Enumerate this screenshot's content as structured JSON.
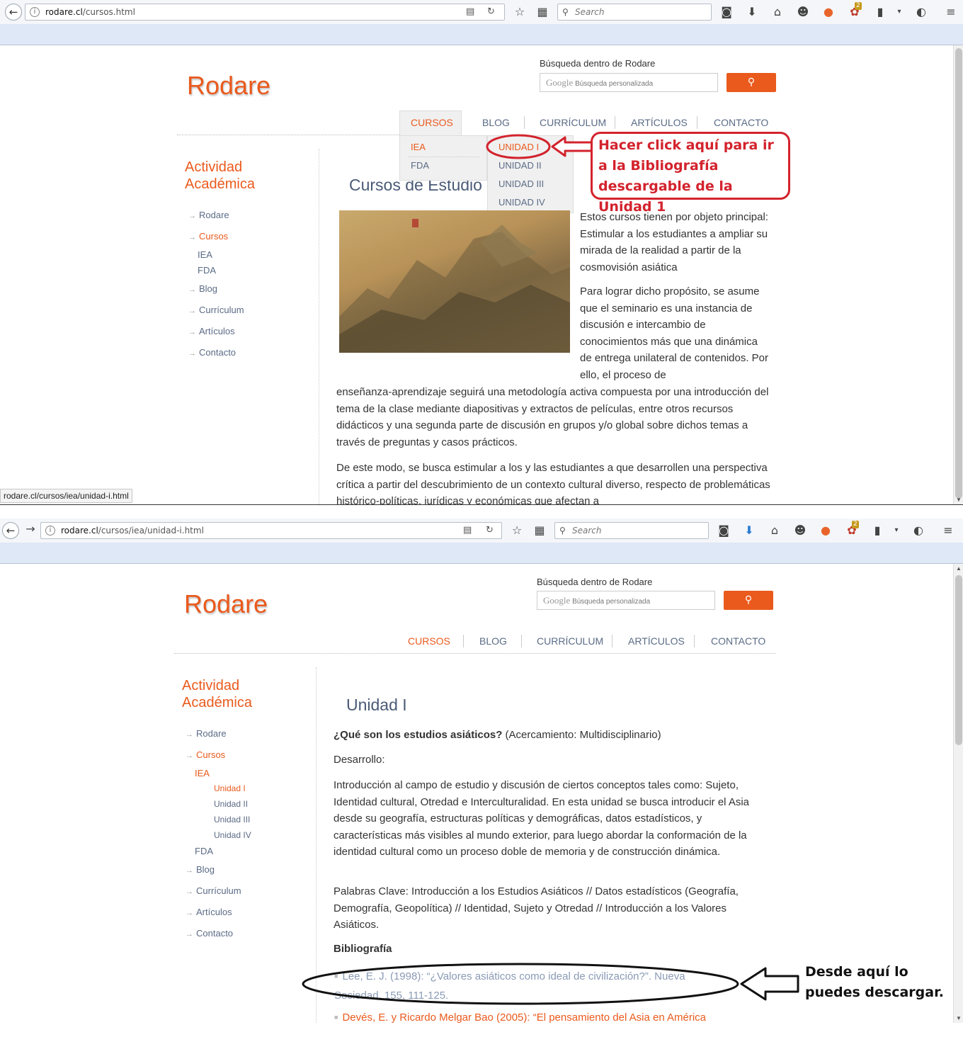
{
  "browser": {
    "search_placeholder": "Search",
    "badge_count": "2"
  },
  "window1": {
    "url_host": "rodare.cl",
    "url_path": "/cursos.html",
    "status_text": "rodare.cl/cursos/iea/unidad-i.html"
  },
  "window2": {
    "url_host": "rodare.cl",
    "url_path": "/cursos/iea/unidad-i.html"
  },
  "site": {
    "logo": "Rodare",
    "search_label": "Búsqueda dentro de Rodare",
    "search_placeholder": "Búsqueda personalizada",
    "google": "Google",
    "nav": [
      "CURSOS",
      "BLOG",
      "CURRÍCULUM",
      "ARTÍCULOS",
      "CONTACTO"
    ],
    "sidebar_title_1": "Actividad",
    "sidebar_title_2": "Académica"
  },
  "page1": {
    "sidebar": [
      "Rodare",
      "Cursos",
      "IEA",
      "FDA",
      "Blog",
      "Currículum",
      "Artículos",
      "Contacto"
    ],
    "dropdown_col1": [
      "IEA",
      "FDA"
    ],
    "dropdown_col2": [
      "UNIDAD I",
      "UNIDAD II",
      "UNIDAD III",
      "UNIDAD IV"
    ],
    "heading": "Cursos de Estudio",
    "para1": "Estos cursos tienen por objeto principal: Estimular a los estudiantes a ampliar su mirada de la realidad a partir de la cosmovisión asiática",
    "para2_a": "Para lograr dicho propósito, se asume que el seminario es una instancia de discusión e intercambio de conocimientos más que una dinámica de entrega unilateral de contenidos. Por ello, el proceso de",
    "para2_b": "enseñanza-aprendizaje seguirá una metodología activa compuesta por una introducción del tema de la clase mediante diapositivas y extractos de películas, entre otros recursos didácticos y una segunda parte de discusión en grupos y/o global sobre dichos temas a través de preguntas y casos prácticos.",
    "para3": "De este modo, se busca estimular a los y las estudiantes a que desarrollen una perspectiva crítica a partir del descubrimiento de un contexto cultural diverso, respecto de problemáticas histórico-políticas, jurídicas y económicas que afectan a",
    "annotation": "Hacer click aquí para ir a la Bibliografía descargable de la Unidad 1"
  },
  "page2": {
    "sidebar": [
      "Rodare",
      "Cursos",
      "IEA",
      "Unidad I",
      "Unidad II",
      "Unidad III",
      "Unidad IV",
      "FDA",
      "Blog",
      "Currículum",
      "Artículos",
      "Contacto"
    ],
    "heading": "Unidad I",
    "question_bold": "¿Qué son los estudios asiáticos?",
    "question_rest": " (Acercamiento: Multidisciplinario)",
    "desarrollo": "Desarrollo:",
    "para1": "Introducción al campo de estudio y discusión de ciertos conceptos tales como: Sujeto, Identidad cultural, Otredad e Interculturalidad. En esta unidad se busca introducir el Asia desde su geografía, estructuras políticas y demográficas, datos estadísticos, y características más visibles al mundo exterior, para luego abordar la conformación de la identidad cultural como un proceso doble de memoria y de construcción dinámica.",
    "para2": "Palabras Clave: Introducción a los Estudios Asiáticos // Datos estadísticos (Geografía, Demografía, Geopolítica) // Identidad, Sujeto y Otredad // Introducción a los Valores Asiáticos.",
    "biblio_title": "Bibliografía",
    "biblio1": "Lee, E. J. (1998): “¿Valores asiáticos como ideal de civilización?”. Nueva Sociedad, 155, 111-125.",
    "biblio2": "Devés, E. y Ricardo Melgar Bao (2005): “El pensamiento del Asia en América",
    "annotation": "Desde aquí lo puedes descargar."
  },
  "colors": {
    "accent": "#ea5a1d",
    "nav_text": "#5b6b86",
    "annotation_red": "#d3232d"
  }
}
